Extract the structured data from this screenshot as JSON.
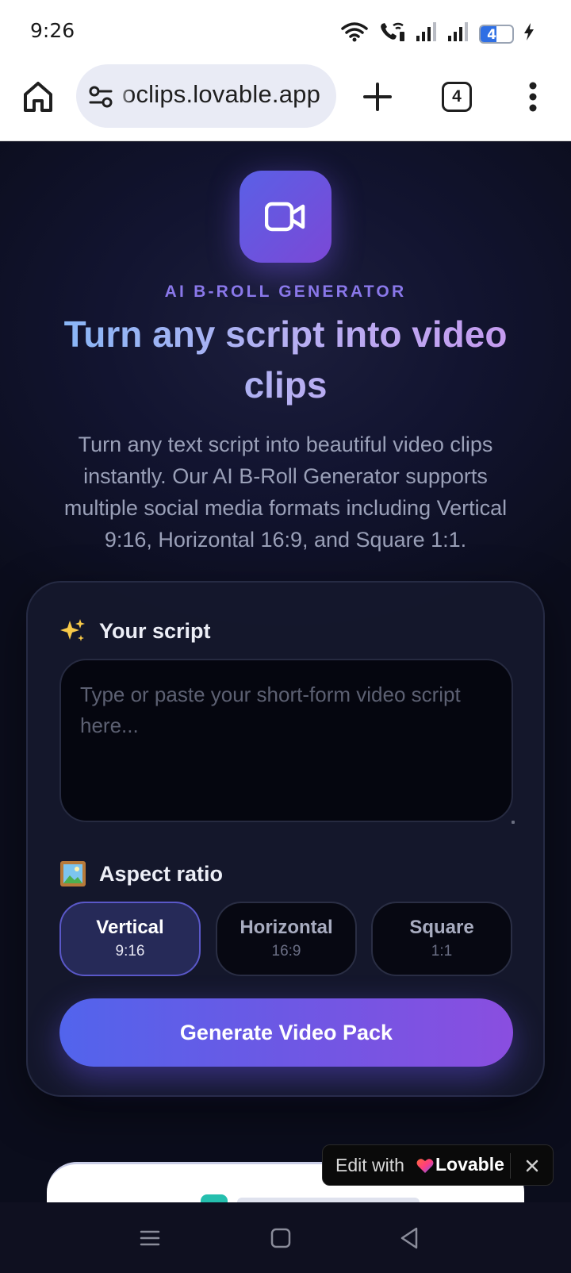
{
  "status_bar": {
    "time": "9:26",
    "battery_level": "49",
    "battery_fraction": 0.49,
    "icons": [
      "wifi-icon",
      "wifi-calling-icon",
      "signal-icon",
      "signal-icon",
      "battery-icon",
      "charging-icon"
    ]
  },
  "browser": {
    "url": "oclips.lovable.app",
    "tab_count": "4",
    "icons": [
      "home-icon",
      "site-settings-icon",
      "new-tab-plus-icon",
      "tab-switcher-icon",
      "more-vert-icon"
    ]
  },
  "hero": {
    "eyebrow": "AI B-ROLL GENERATOR",
    "title": "Turn any script into video clips",
    "description": "Turn any text script into beautiful video clips instantly. Our AI B-Roll Generator supports multiple social media formats including Vertical 9:16, Horizontal 16:9, and Square 1:1.",
    "logo_icon": "video-camera-icon"
  },
  "form": {
    "script_label": "Your script",
    "script_label_icon": "sparkles-icon",
    "script_placeholder": "Type or paste your short-form video script here...",
    "script_value": "",
    "ratio_label": "Aspect ratio",
    "ratio_label_icon": "framed-picture-icon",
    "ratios": [
      {
        "name": "Vertical",
        "value": "9:16",
        "selected": true
      },
      {
        "name": "Horizontal",
        "value": "16:9",
        "selected": false
      },
      {
        "name": "Square",
        "value": "1:1",
        "selected": false
      }
    ],
    "generate_label": "Generate Video Pack"
  },
  "badge": {
    "edit_with": "Edit with",
    "brand": "Lovable"
  },
  "colors": {
    "accent_start": "#5264ec",
    "accent_end": "#8a4ee0",
    "background": "#0b0d1c",
    "eyebrow": "#8a78ea"
  },
  "nav_bar": {
    "icons": [
      "menu-icon",
      "home-square-icon",
      "back-triangle-icon"
    ]
  }
}
